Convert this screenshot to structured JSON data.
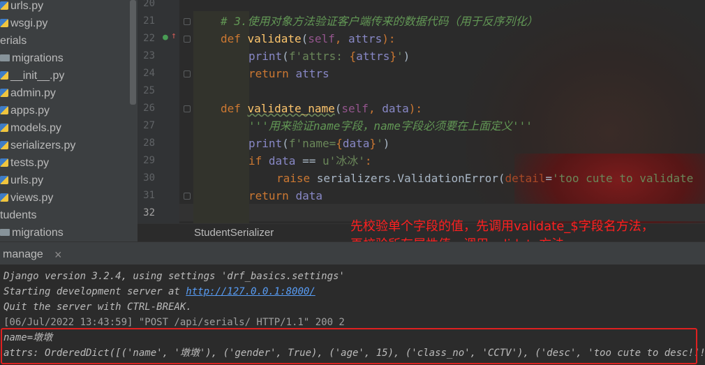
{
  "project_tree": {
    "items": [
      {
        "label": "urls.py",
        "type": "py"
      },
      {
        "label": "wsgi.py",
        "type": "py"
      },
      {
        "label": "erials",
        "type": "dir"
      },
      {
        "label": "migrations",
        "type": "dir"
      },
      {
        "label": "__init__.py",
        "type": "py"
      },
      {
        "label": "admin.py",
        "type": "py"
      },
      {
        "label": "apps.py",
        "type": "py"
      },
      {
        "label": "models.py",
        "type": "py"
      },
      {
        "label": "serializers.py",
        "type": "py"
      },
      {
        "label": "tests.py",
        "type": "py"
      },
      {
        "label": "urls.py",
        "type": "py"
      },
      {
        "label": "views.py",
        "type": "py"
      },
      {
        "label": "tudents",
        "type": "dir"
      },
      {
        "label": "migrations",
        "type": "dir"
      }
    ]
  },
  "editor": {
    "line_numbers": [
      "20",
      "21",
      "22",
      "23",
      "24",
      "25",
      "26",
      "27",
      "28",
      "29",
      "30",
      "31",
      "32"
    ],
    "line21_comment": "# 3.使用对象方法验证客户端传来的数据代码（用于反序列化）",
    "line22": {
      "kw": "def ",
      "fn": "validate",
      "p1": "(",
      "self": "self",
      "sep": ", ",
      "param": "attrs",
      "p2": "):"
    },
    "line23": {
      "bi": "print",
      "open": "(",
      "str1": "f'attrs: ",
      "brace_open": "{",
      "var": "attrs",
      "brace_close": "}",
      "str2": "'",
      "close": ")"
    },
    "line24": {
      "kw": "return ",
      "var": "attrs"
    },
    "line26": {
      "kw": "def ",
      "fn": "validate_name",
      "p1": "(",
      "self": "self",
      "sep": ", ",
      "param": "data",
      "p2": "):"
    },
    "line27_doc": "'''用来验证name字段，name字段必须要在上面定义'''",
    "line28": {
      "bi": "print",
      "open": "(",
      "str1": "f'name=",
      "brace_open": "{",
      "var": "data",
      "brace_close": "}",
      "str2": "'",
      "close": ")"
    },
    "line29": {
      "kw": "if ",
      "var": "data",
      "op": " == ",
      "str": "u'冰冰'",
      "colon": ":"
    },
    "line30": {
      "kw": "raise ",
      "mod": "serializers",
      "dot": ".",
      "cls": "ValidationError",
      "open": "(",
      "param": "detail",
      "eq": "=",
      "str": "'too cute to validate",
      "rest": ""
    },
    "line31": {
      "kw": "return ",
      "var": "data"
    },
    "gutter_mark_icon": "override-icon",
    "breadcrumb": "StudentSerializer"
  },
  "annotation": {
    "line1": "先校验单个字段的值，先调用validate_$字段名方法，",
    "line2": "再校验所有属性值，调用validate方法",
    "color": "#ff2020"
  },
  "run_panel": {
    "tab_label": "manage",
    "close_glyph": "×",
    "lines": {
      "l1": "Django version 3.2.4, using settings 'drf_basics.settings'",
      "l2_prefix": "Starting development server at ",
      "l2_link": "http://127.0.0.1:8000/",
      "l3": "Quit the server with CTRL-BREAK.",
      "l4": "[06/Jul/2022 13:43:59] \"POST /api/serials/ HTTP/1.1\" 200 2",
      "l5": "name=墩墩",
      "l6": "attrs: OrderedDict([('name', '墩墩'), ('gender', True), ('age', 15), ('class_no', 'CCTV'), ('desc', 'too cute to desc!!!')])"
    }
  },
  "colors": {
    "keyword": "#cc7832",
    "function": "#ffc66d",
    "string": "#6a8759",
    "comment": "#629755",
    "highlight_box": "#e02020"
  }
}
